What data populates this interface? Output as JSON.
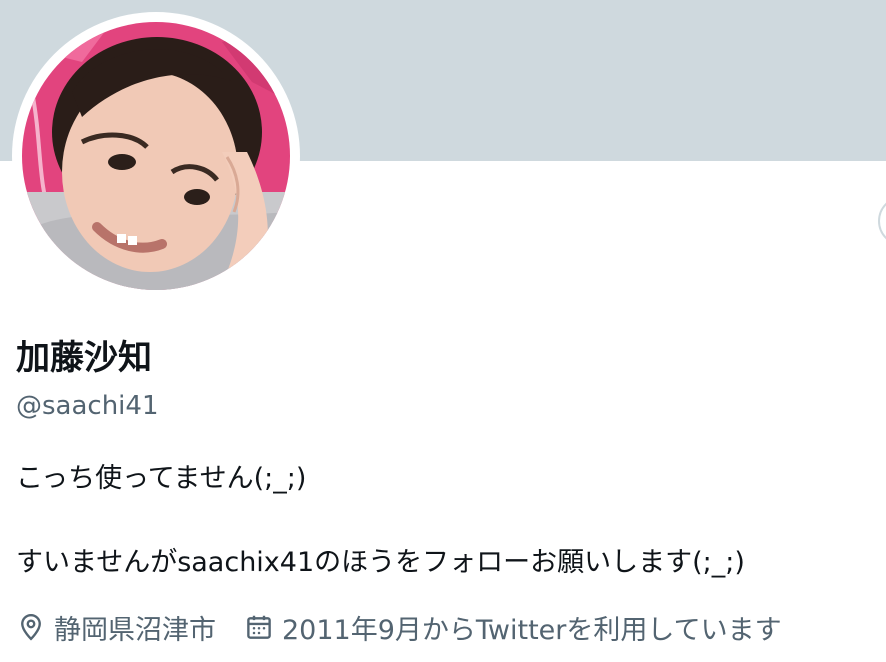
{
  "profile": {
    "display_name": "加藤沙知",
    "handle": "@saachi41",
    "bio_lines": [
      "こっち使ってません(;_;)",
      "すいませんがsaachix41のほうをフォローお願いします(;_;)"
    ]
  },
  "meta": {
    "location": "静岡県沼津市",
    "location_icon": "location-pin-icon",
    "joined": "2011年9月からTwitterを利用しています",
    "joined_icon": "calendar-icon"
  },
  "colors": {
    "banner": "#cfd9de",
    "text_primary": "#0f1419",
    "text_secondary": "#536471",
    "background": "#ffffff"
  }
}
